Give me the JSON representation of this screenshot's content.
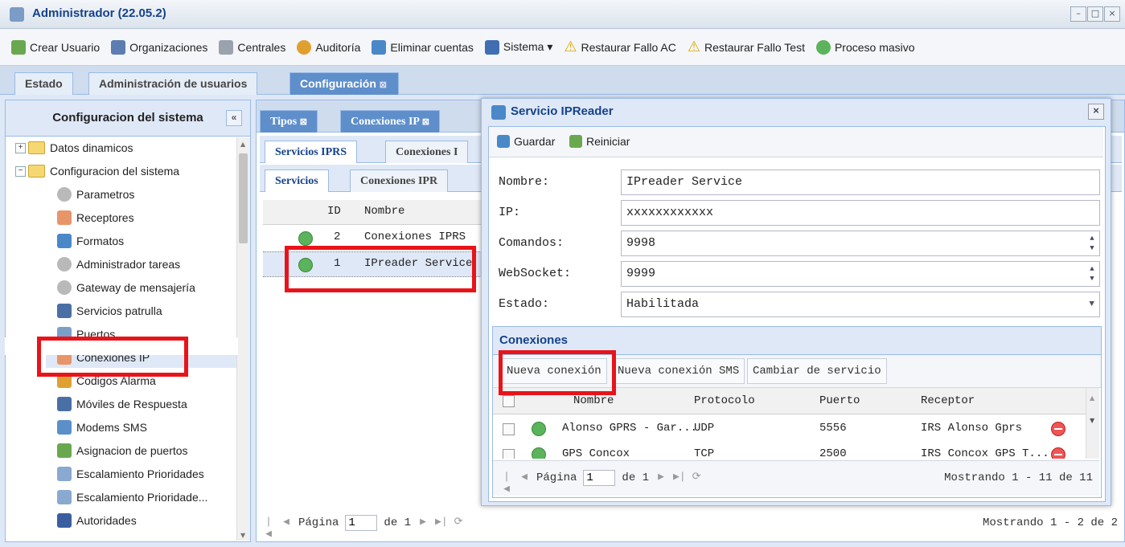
{
  "window": {
    "title": "Administrador (22.05.2)",
    "controls": [
      "–",
      "□",
      "×"
    ]
  },
  "toolbar": {
    "items": [
      {
        "label": "Crear Usuario",
        "icon": "add-user-icon",
        "color": "#6aa84f"
      },
      {
        "label": "Organizaciones",
        "icon": "organization-icon",
        "color": "#5b7db1"
      },
      {
        "label": "Centrales",
        "icon": "document-icon",
        "color": "#9aa3ad"
      },
      {
        "label": "Auditoría",
        "icon": "audit-icon",
        "color": "#e0a030"
      },
      {
        "label": "Eliminar cuentas",
        "icon": "delete-accounts-icon",
        "color": "#4a88c8"
      },
      {
        "label": "Sistema ▾",
        "icon": "monitor-icon",
        "color": "#3f6fb0"
      },
      {
        "label": "Restaurar Fallo AC",
        "icon": "warning-icon",
        "color": "#f2c230"
      },
      {
        "label": "Restaurar Fallo Test",
        "icon": "warning-icon",
        "color": "#f2c230"
      },
      {
        "label": "Proceso masivo",
        "icon": "check-circle-icon",
        "color": "#5bb35b"
      }
    ]
  },
  "main_tabs": [
    {
      "label": "Estado"
    },
    {
      "label": "Administración de usuarios"
    },
    {
      "label": "Configuración",
      "close": "⊠"
    }
  ],
  "left_panel": {
    "title": "Configuracion del sistema",
    "collapse": "«",
    "items": [
      {
        "label": "Datos dinamicos",
        "icon": "folder-icon",
        "expander": "+"
      },
      {
        "label": "Configuracion del sistema",
        "icon": "folder-open-icon",
        "expander": "−"
      },
      {
        "label": "Parametros",
        "icon": "gear-icon"
      },
      {
        "label": "Receptores",
        "icon": "antenna-icon"
      },
      {
        "label": "Formatos",
        "icon": "code-icon"
      },
      {
        "label": "Administrador tareas",
        "icon": "gear-icon"
      },
      {
        "label": "Gateway de mensajería",
        "icon": "gear-icon"
      },
      {
        "label": "Servicios patrulla",
        "icon": "car-icon"
      },
      {
        "label": "Puertos",
        "icon": "plug-icon"
      },
      {
        "label": "Conexiones IP",
        "icon": "antenna-icon"
      },
      {
        "label": "Codigos Alarma",
        "icon": "alarm-icon"
      },
      {
        "label": "Móviles de Respuesta",
        "icon": "car-icon"
      },
      {
        "label": "Modems SMS",
        "icon": "modem-icon"
      },
      {
        "label": "Asignacion de puertos",
        "icon": "chart-icon"
      },
      {
        "label": "Escalamiento Prioridades",
        "icon": "list-icon"
      },
      {
        "label": "Escalamiento Prioridade...",
        "icon": "list-icon"
      },
      {
        "label": "Autoridades",
        "icon": "shield-icon"
      }
    ]
  },
  "center": {
    "tabs": [
      {
        "label": "Tipos",
        "close": "⊠"
      },
      {
        "label": "Conexiones IP",
        "close": "⊠"
      }
    ],
    "subtabs": [
      "Servicios IPRS",
      "Conexiones I"
    ],
    "subtabs2": [
      "Servicios",
      "Conexiones IPR"
    ],
    "columns": [
      "ID",
      "Nombre"
    ],
    "rows": [
      {
        "id": "2",
        "name": "Conexiones IPRS"
      },
      {
        "id": "1",
        "name": "IPreader Service"
      }
    ],
    "pager": {
      "page_label": "Página",
      "page": "1",
      "of": "de 1"
    },
    "showing": "Mostrando 1 - 2 de 2"
  },
  "dialog": {
    "title": "Servicio IPReader",
    "close": "×",
    "save_label": "Guardar",
    "reset_label": "Reiniciar",
    "fields": {
      "name_label": "Nombre:",
      "name_value": "IPreader Service",
      "ip_label": "IP:",
      "ip_value": "xxxxxxxxxxxx",
      "commands_label": "Comandos:",
      "commands_value": "9998",
      "websocket_label": "WebSocket:",
      "websocket_value": "9999",
      "state_label": "Estado:",
      "state_value": "Habilitada"
    },
    "connections": {
      "title": "Conexiones",
      "buttons": [
        "Nueva conexión",
        "Nueva conexión SMS",
        "Cambiar de servicio"
      ],
      "columns": [
        "Nombre",
        "Protocolo",
        "Puerto",
        "Receptor"
      ],
      "rows": [
        {
          "name": "Alonso GPRS - Gar...",
          "protocol": "UDP",
          "port": "5556",
          "receiver": "IRS Alonso Gprs"
        },
        {
          "name": "GPS Concox",
          "protocol": "TCP",
          "port": "2500",
          "receiver": "IRS Concox GPS T..."
        }
      ],
      "pager": {
        "page_label": "Página",
        "page": "1",
        "of": "de 1"
      },
      "showing": "Mostrando 1 - 11 de 11"
    }
  }
}
